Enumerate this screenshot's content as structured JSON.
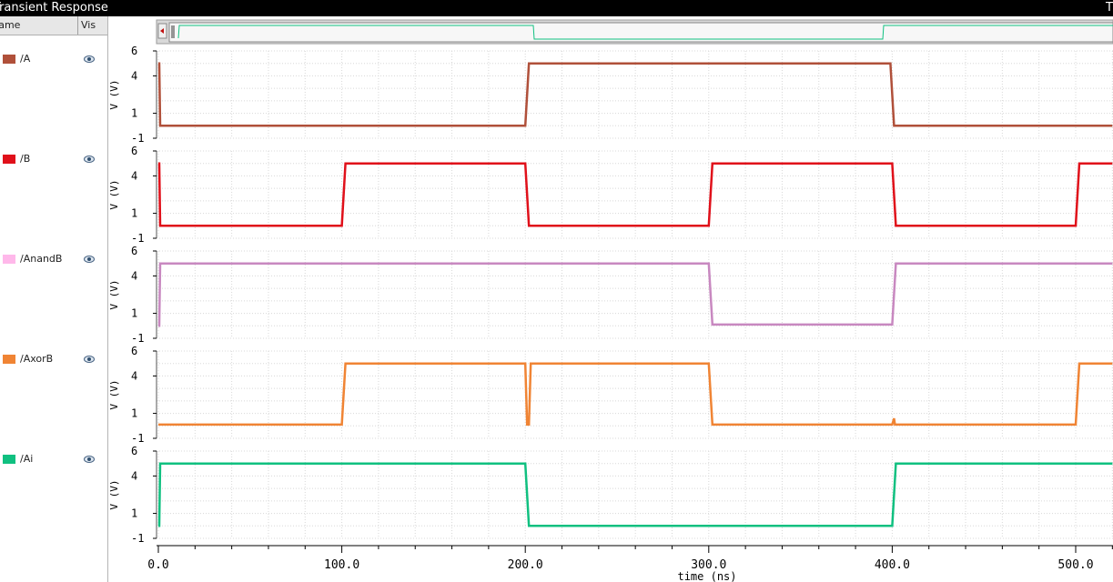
{
  "window": {
    "title": "Transient Response",
    "title_right": "T"
  },
  "sidebar": {
    "col_name": "Name",
    "col_vis": "Vis"
  },
  "colors": {
    "A": "#b0503a",
    "B": "#e0101a",
    "AnandB": "#c888c0",
    "AxorB": "#f08434",
    "Ai": "#10c080"
  },
  "chart_data": {
    "type": "line",
    "xlabel": "time (ns)",
    "ylabel": "V (V)",
    "xlim": [
      0,
      520
    ],
    "ylim": [
      -1,
      6
    ],
    "x_ticks": [
      "0.0",
      "100.0",
      "200.0",
      "300.0",
      "400.0",
      "500.0"
    ],
    "y_ticks": [
      "-1",
      "1",
      "4",
      "6"
    ],
    "grid": true,
    "series": [
      {
        "name": "/A",
        "color": "#b0503a",
        "points": [
          [
            0,
            5
          ],
          [
            0.5,
            5
          ],
          [
            1,
            0
          ],
          [
            200,
            0
          ],
          [
            202,
            5
          ],
          [
            399,
            5
          ],
          [
            401,
            0
          ],
          [
            520,
            0
          ]
        ]
      },
      {
        "name": "/B",
        "color": "#e0101a",
        "points": [
          [
            0,
            5
          ],
          [
            0.5,
            5
          ],
          [
            1,
            0
          ],
          [
            100,
            0
          ],
          [
            102,
            5
          ],
          [
            200,
            5
          ],
          [
            202,
            0
          ],
          [
            300,
            0
          ],
          [
            302,
            5
          ],
          [
            400,
            5
          ],
          [
            402,
            0
          ],
          [
            500,
            0
          ],
          [
            502,
            5
          ],
          [
            520,
            5
          ]
        ]
      },
      {
        "name": "/AnandB",
        "color": "#c888c0",
        "points": [
          [
            0,
            0
          ],
          [
            0.5,
            0
          ],
          [
            1,
            5
          ],
          [
            300,
            5
          ],
          [
            302,
            0.1
          ],
          [
            400,
            0.1
          ],
          [
            402,
            5
          ],
          [
            520,
            5
          ]
        ]
      },
      {
        "name": "/AxorB",
        "color": "#f08434",
        "points": [
          [
            0,
            0.1
          ],
          [
            100,
            0.1
          ],
          [
            102,
            5
          ],
          [
            200,
            5
          ],
          [
            201,
            0.1
          ],
          [
            202,
            0.1
          ],
          [
            203,
            5
          ],
          [
            300,
            5
          ],
          [
            302,
            0.1
          ],
          [
            400,
            0.1
          ],
          [
            401,
            0.6
          ],
          [
            401.5,
            0.1
          ],
          [
            500,
            0.1
          ],
          [
            502,
            5
          ],
          [
            520,
            5
          ]
        ]
      },
      {
        "name": "/Ai",
        "color": "#10c080",
        "points": [
          [
            0,
            0
          ],
          [
            0.5,
            0
          ],
          [
            1,
            5
          ],
          [
            200,
            5
          ],
          [
            202,
            0
          ],
          [
            400,
            0
          ],
          [
            402,
            5
          ],
          [
            520,
            5
          ]
        ]
      }
    ]
  }
}
